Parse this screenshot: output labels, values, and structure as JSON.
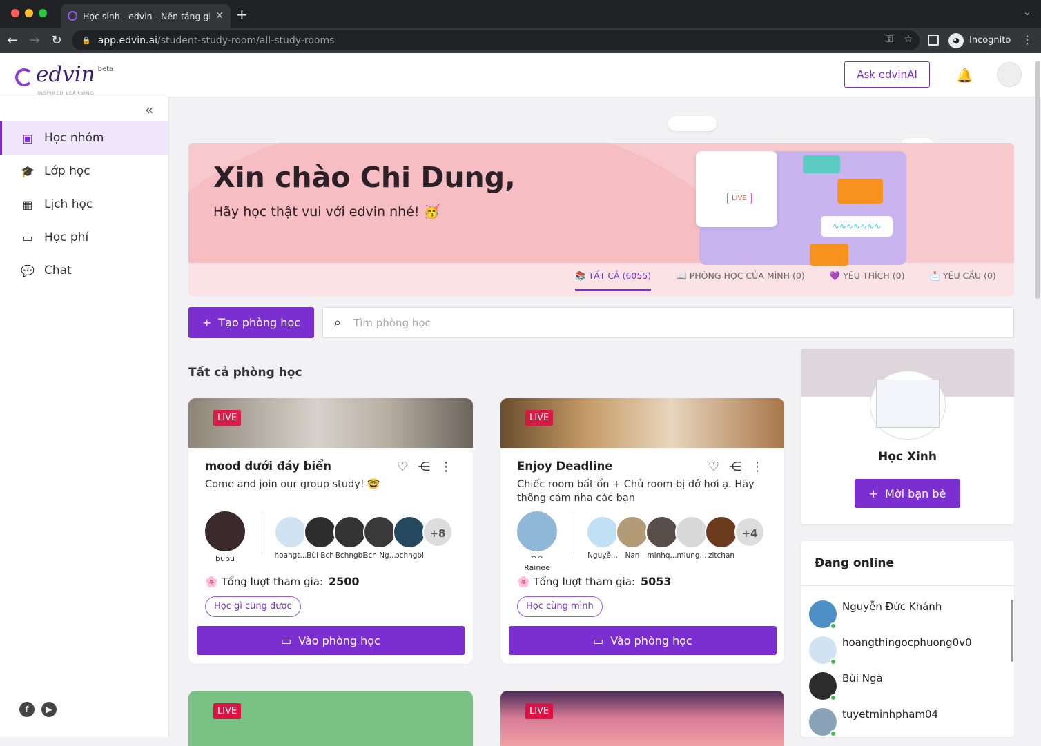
{
  "browser": {
    "tab_title": "Học sinh - edvin - Nền tảng giá",
    "url_host": "app.edvin.ai",
    "url_path": "/student-study-room/all-study-rooms",
    "profile_label": "Incognito"
  },
  "header": {
    "logo_text": "edvin",
    "logo_badge": "beta",
    "logo_tagline": "INSPIRED LEARNING",
    "ask_button": "Ask edvinAI"
  },
  "sidebar": {
    "items": [
      {
        "label": "Học nhóm",
        "icon": "group-study-icon"
      },
      {
        "label": "Lớp học",
        "icon": "graduation-cap-icon"
      },
      {
        "label": "Lịch học",
        "icon": "calendar-icon"
      },
      {
        "label": "Học phí",
        "icon": "credit-card-icon"
      },
      {
        "label": "Chat",
        "icon": "chat-icon"
      }
    ]
  },
  "hero": {
    "greeting": "Xin chào Chi Dung,",
    "subtitle": "Hãy học thật vui với edvin nhé! 🥳",
    "live_label": "LIVE",
    "tabs": [
      "📚 TẤT CẢ (6055)",
      "📖 PHÒNG HỌC CỦA MÌNH (0)",
      "💜 YÊU THÍCH (0)",
      "📩 YÊU CẦU (0)"
    ]
  },
  "toolbar": {
    "create_button": "Tạo phòng học",
    "search_placeholder": "Tìm phòng học"
  },
  "section_title": "Tất cả phòng học",
  "rooms": [
    {
      "live": "LIVE",
      "title": "mood dưới đáy biển",
      "description": "Come and join our group study! 🤓",
      "host": "bubu",
      "members": [
        "hoangt...",
        "Bùi Bch",
        "Bchngbi",
        "Bch Ng...",
        "bchngbi"
      ],
      "more": "+8",
      "total_label": "🌸 Tổng lượt tham gia:",
      "total_value": "2500",
      "tag": "Học gì cũng được",
      "enter_button": "Vào phòng học"
    },
    {
      "live": "LIVE",
      "title": "Enjoy Deadline",
      "description": "Chiếc room bất ổn + Chủ room bị dở hơi ạ. Hãy thông cảm nha các bạn",
      "host": "^^ Rainee",
      "members": [
        "Nguyễ...",
        "Nan",
        "minhq...",
        "miung...",
        "zitchan"
      ],
      "more": "+4",
      "total_label": "🌸 Tổng lượt tham gia:",
      "total_value": "5053",
      "tag": "Học cùng mình",
      "enter_button": "Vào phòng học"
    },
    {
      "live": "LIVE"
    },
    {
      "live": "LIVE"
    }
  ],
  "profile": {
    "name": "Học Xinh",
    "invite_button": "Mời bạn bè"
  },
  "online": {
    "title": "Đang online",
    "users": [
      "Nguyễn Đức Khánh",
      "hoangthingocphuong0v0",
      "Bùi Ngà",
      "tuyetminhpham04"
    ]
  },
  "colors": {
    "accent": "#7b2fd0",
    "hero_bg": "#f7c8cc",
    "live_badge": "#d14",
    "online_dot": "#3dbb55"
  }
}
